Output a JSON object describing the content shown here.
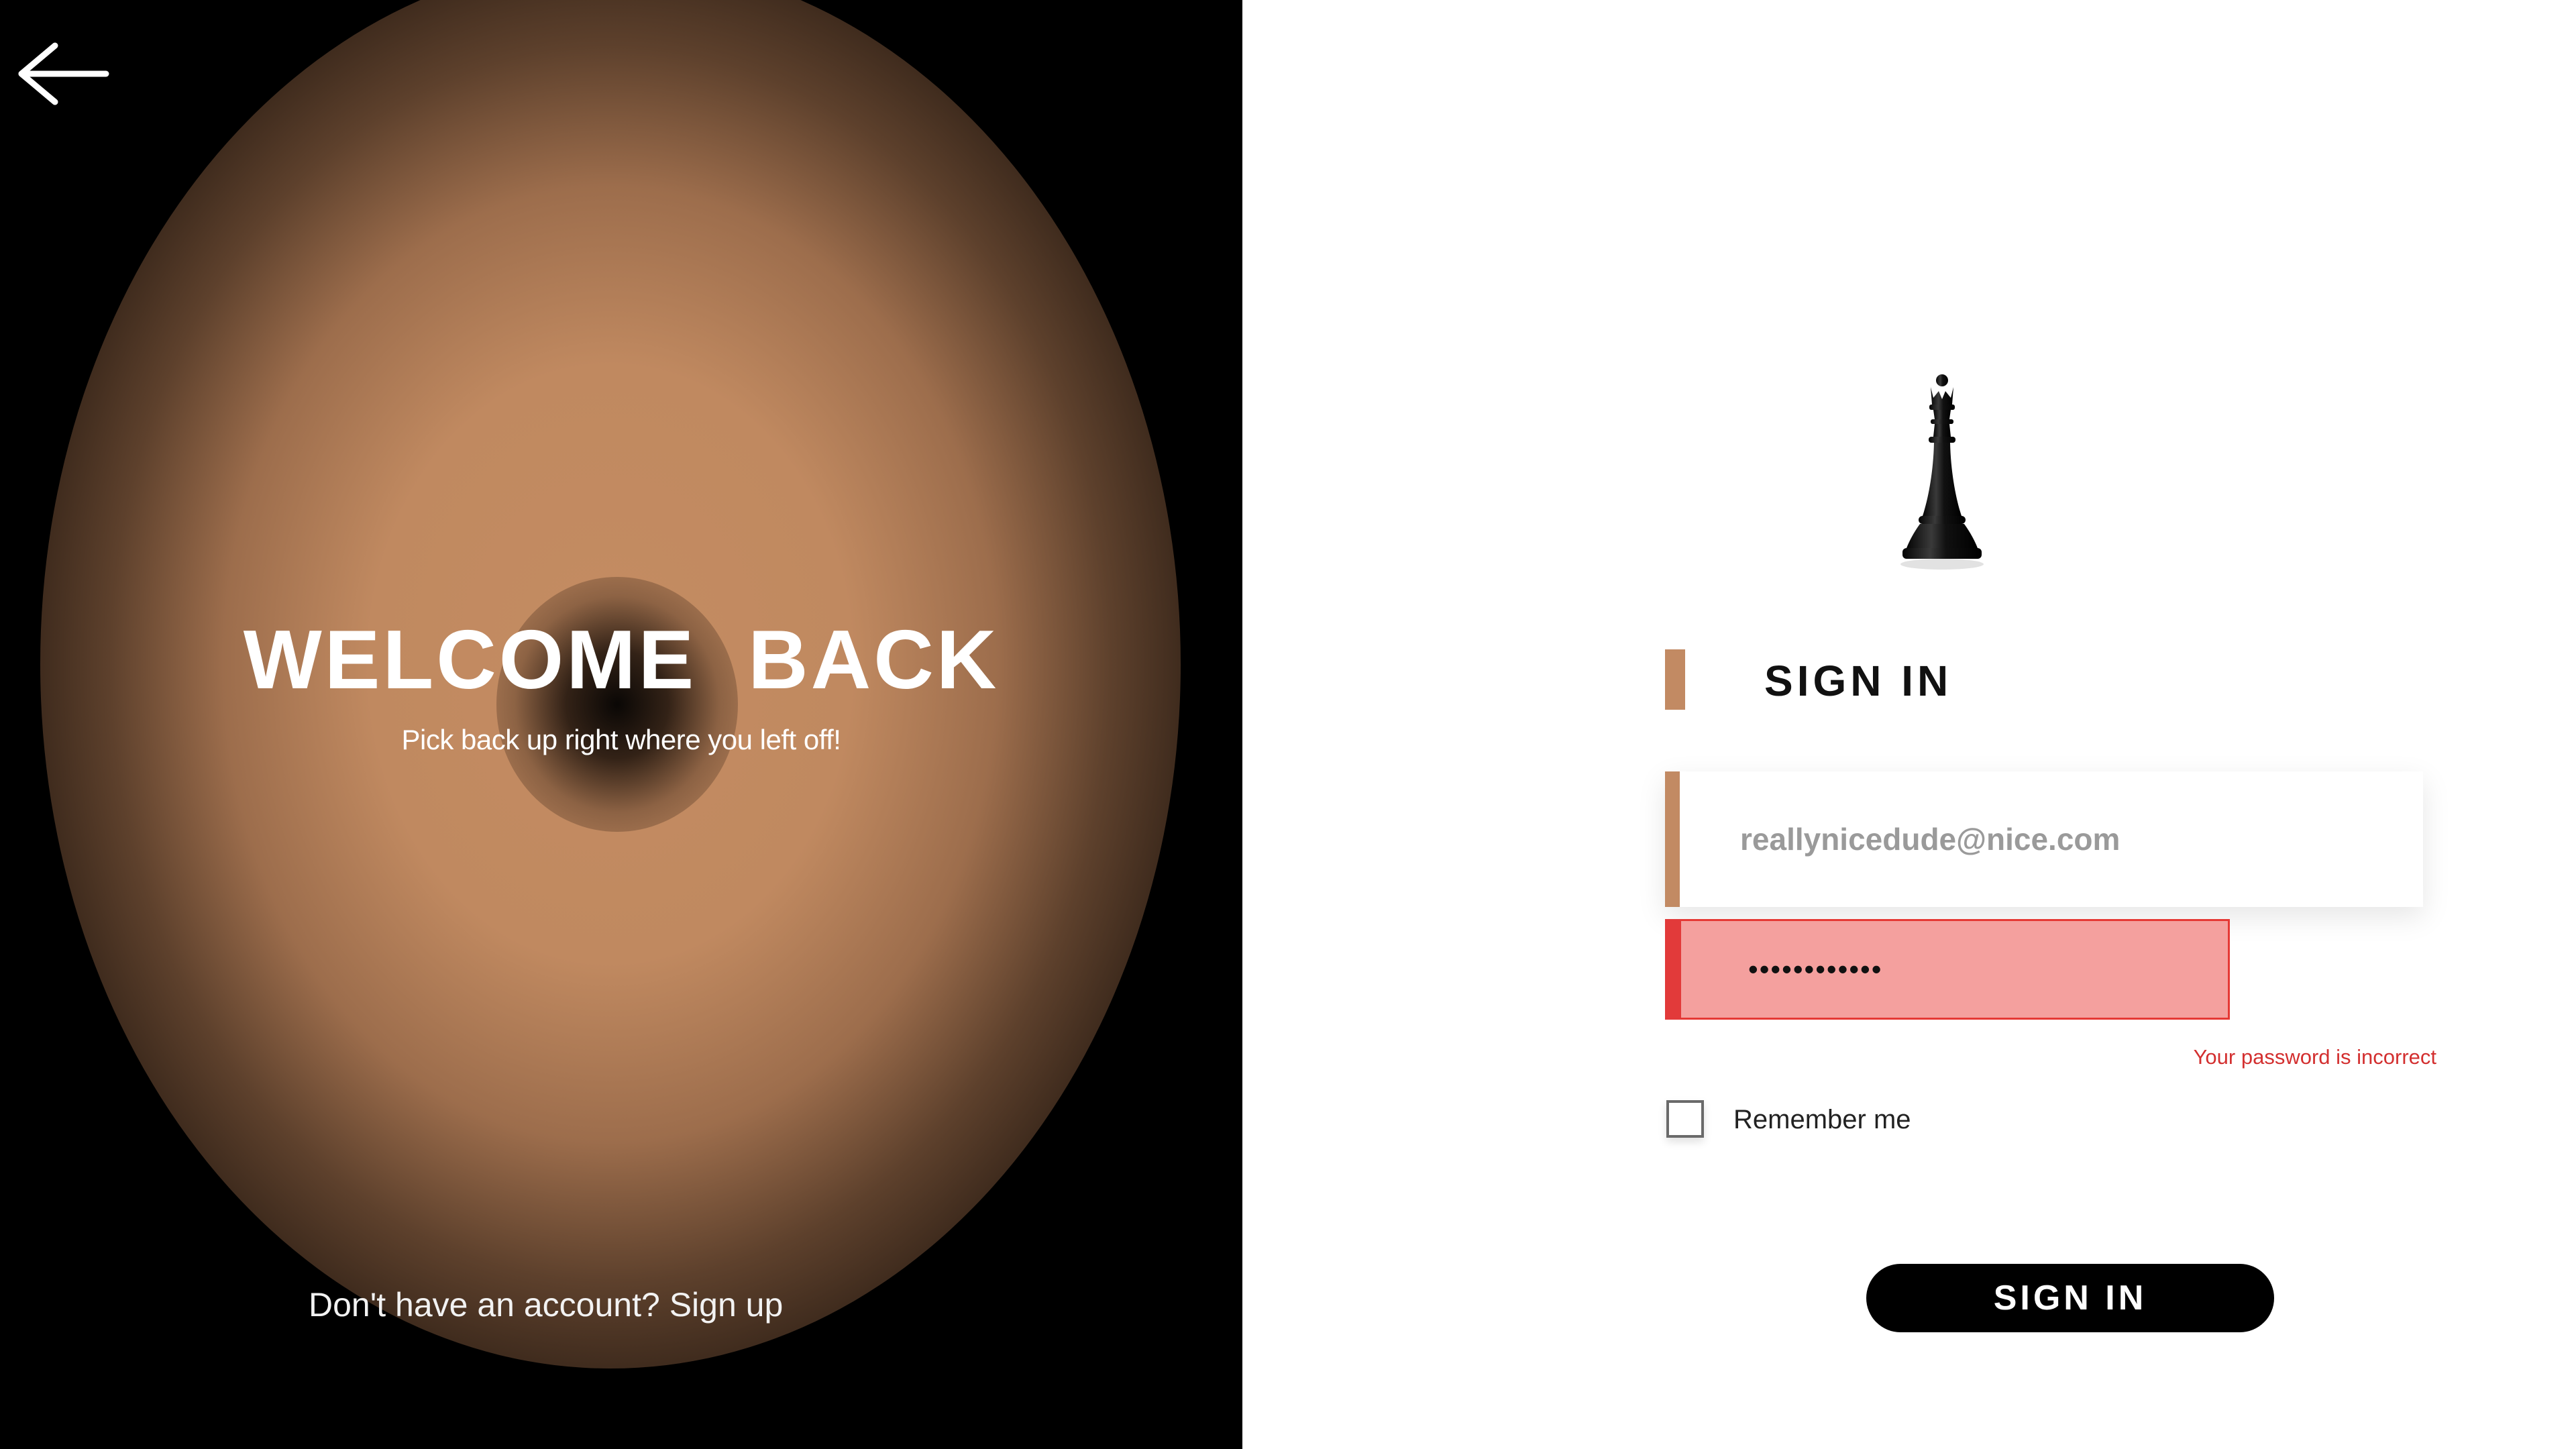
{
  "left_panel": {
    "title": "WELCOME  BACK",
    "subtitle": "Pick back up right where you left off!",
    "signup_prompt": "Don't have an account? Sign up",
    "back_icon": "arrow-left-icon",
    "glow_color": "#c28a63"
  },
  "right_panel": {
    "logo_icon": "chess-queen-icon",
    "heading": "SIGN IN",
    "accent_color": "#c28a63",
    "email": {
      "value": "reallynicedude@nice.com"
    },
    "password": {
      "value": "••••••••••••",
      "state": "error",
      "error_color": "#e53935",
      "error_background": "#f4a09e"
    },
    "error_message": "Your password is incorrect",
    "remember_me": {
      "label": "Remember me",
      "checked": false
    },
    "submit_label": "SIGN IN"
  }
}
